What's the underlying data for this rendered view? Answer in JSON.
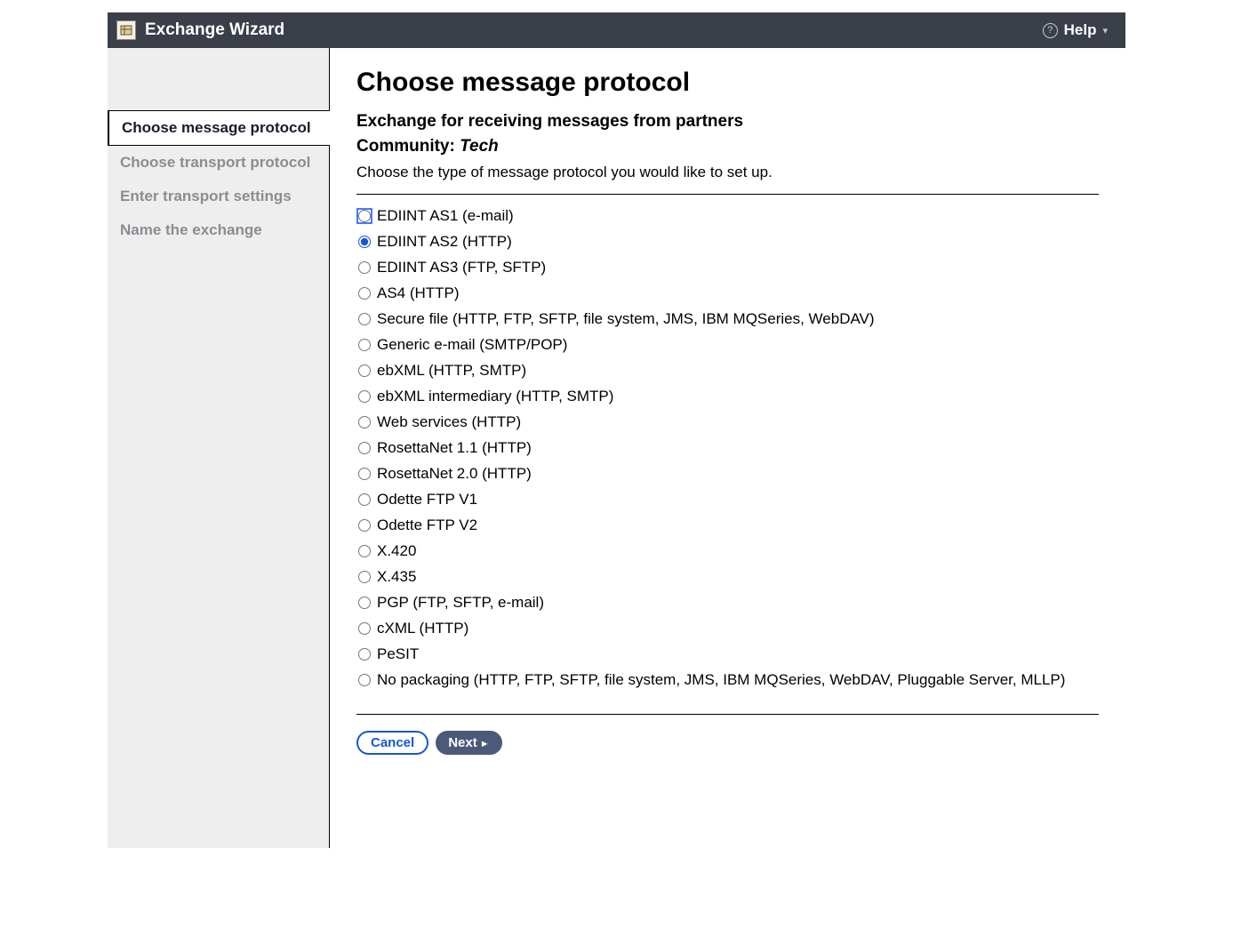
{
  "header": {
    "title": "Exchange Wizard",
    "help_label": "Help"
  },
  "sidebar": {
    "steps": [
      "Choose message protocol",
      "Choose transport protocol",
      "Enter transport settings",
      "Name the exchange"
    ],
    "active_index": 0
  },
  "main": {
    "page_title": "Choose message protocol",
    "subtitle": "Exchange for receiving messages from partners",
    "community_label": "Community:",
    "community_name": "Tech",
    "description": "Choose the type of message protocol you would like to set up.",
    "options": [
      "EDIINT AS1 (e-mail)",
      "EDIINT AS2 (HTTP)",
      "EDIINT AS3 (FTP, SFTP)",
      "AS4 (HTTP)",
      "Secure file (HTTP, FTP, SFTP, file system, JMS, IBM MQSeries, WebDAV)",
      "Generic e-mail (SMTP/POP)",
      "ebXML (HTTP, SMTP)",
      "ebXML intermediary (HTTP, SMTP)",
      "Web services (HTTP)",
      "RosettaNet 1.1 (HTTP)",
      "RosettaNet 2.0 (HTTP)",
      "Odette FTP V1",
      "Odette FTP V2",
      "X.420",
      "X.435",
      "PGP (FTP, SFTP, e-mail)",
      "cXML (HTTP)",
      "PeSIT",
      "No packaging (HTTP, FTP, SFTP, file system, JMS, IBM MQSeries, WebDAV, Pluggable Server, MLLP)"
    ],
    "selected_index": 1,
    "focused_index": 0,
    "cancel_label": "Cancel",
    "next_label": "Next"
  }
}
